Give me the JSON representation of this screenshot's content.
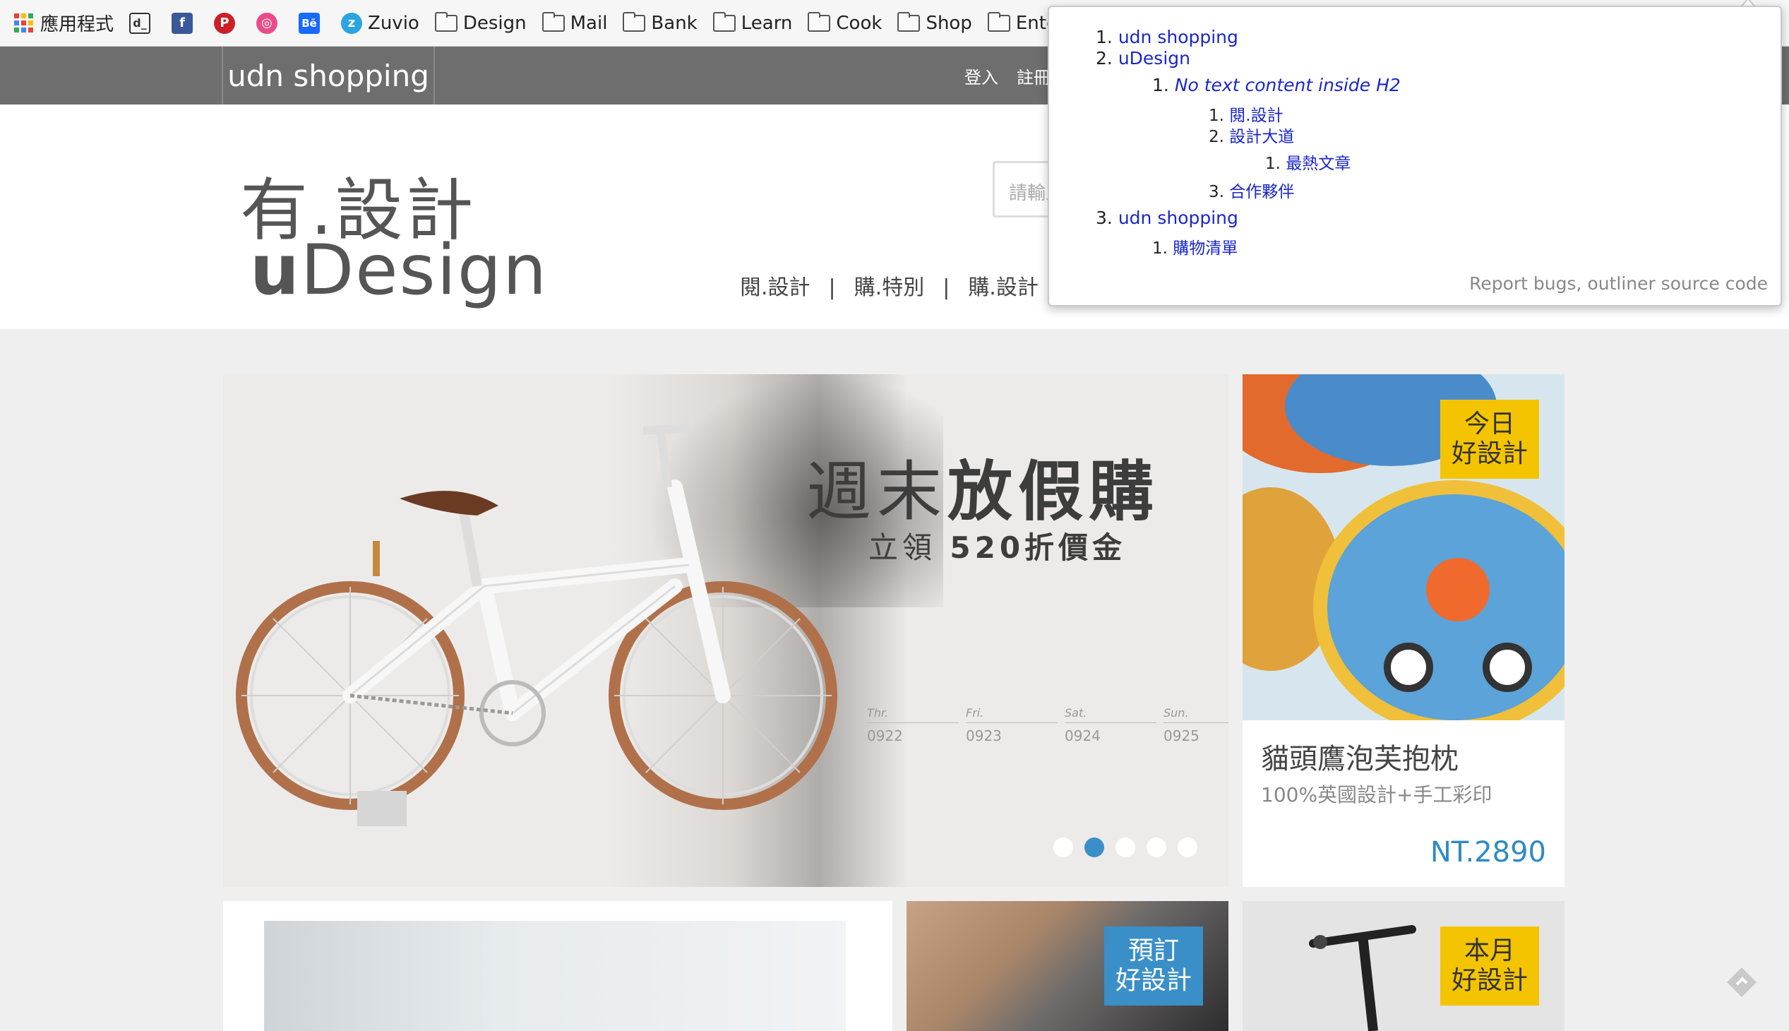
{
  "bookmarks": {
    "items": [
      {
        "label": "應用程式",
        "icon": "apps-icon"
      },
      {
        "label": "",
        "icon": "dc-icon"
      },
      {
        "label": "",
        "icon": "facebook-icon"
      },
      {
        "label": "",
        "icon": "pinterest-icon"
      },
      {
        "label": "",
        "icon": "dribbble-icon"
      },
      {
        "label": "",
        "icon": "behance-icon"
      },
      {
        "label": "Zuvio",
        "icon": "zuvio-icon"
      },
      {
        "label": "Design",
        "icon": "folder-icon"
      },
      {
        "label": "Mail",
        "icon": "folder-icon"
      },
      {
        "label": "Bank",
        "icon": "folder-icon"
      },
      {
        "label": "Learn",
        "icon": "folder-icon"
      },
      {
        "label": "Cook",
        "icon": "folder-icon"
      },
      {
        "label": "Shop",
        "icon": "folder-icon"
      },
      {
        "label": "Entertainment",
        "icon": "folder-icon"
      }
    ]
  },
  "site": {
    "brand": "udn shopping",
    "topnav": {
      "login": "登入",
      "register": "註冊"
    },
    "logo_cn": "有.設計",
    "logo_en_bold": "u",
    "logo_en_rest": "Design",
    "search_placeholder": "請輸入",
    "mainnav": [
      "閱.設計",
      "購.特別",
      "購.設計"
    ],
    "mainnav_sep": "|"
  },
  "hero": {
    "title_light": "週末",
    "title_bold": "放假購",
    "sub_light": "立領",
    "sub_bold": "520",
    "sub_rest": "折價金",
    "dates": [
      {
        "day": "Thr.",
        "date": "0922"
      },
      {
        "day": "Fri.",
        "date": "0923"
      },
      {
        "day": "Sat.",
        "date": "0924"
      },
      {
        "day": "Sun.",
        "date": "0925"
      }
    ],
    "active_slide": 2,
    "slide_count": 5
  },
  "product_card": {
    "badge_line1": "今日",
    "badge_line2": "好設計",
    "title": "貓頭鷹泡芙抱枕",
    "subtitle": "100%英國設計+手工彩印",
    "price": "NT.2890"
  },
  "bottom_tiles": {
    "tile2_badge_line1": "預訂",
    "tile2_badge_line2": "好設計",
    "tile3_badge_line1": "本月",
    "tile3_badge_line2": "好設計"
  },
  "outliner": {
    "items": [
      {
        "num": "1.",
        "text": "udn shopping"
      },
      {
        "num": "2.",
        "text": "uDesign"
      },
      {
        "num": "1.",
        "text": "No text content inside H2"
      },
      {
        "num": "1.",
        "text": "閱.設計"
      },
      {
        "num": "2.",
        "text": "設計大道"
      },
      {
        "num": "1.",
        "text": "最熱文章"
      },
      {
        "num": "3.",
        "text": "合作夥伴"
      },
      {
        "num": "3.",
        "text": "udn shopping"
      },
      {
        "num": "1.",
        "text": "購物清單"
      }
    ],
    "footer_link1": "Report bugs",
    "footer_sep": ",",
    "footer_link2": "outliner source code"
  },
  "colors": {
    "topbar": "#6e6e6e",
    "accent_blue": "#3a8fc8",
    "badge_yellow": "#f4c400",
    "link_blue": "#1a27c9"
  }
}
